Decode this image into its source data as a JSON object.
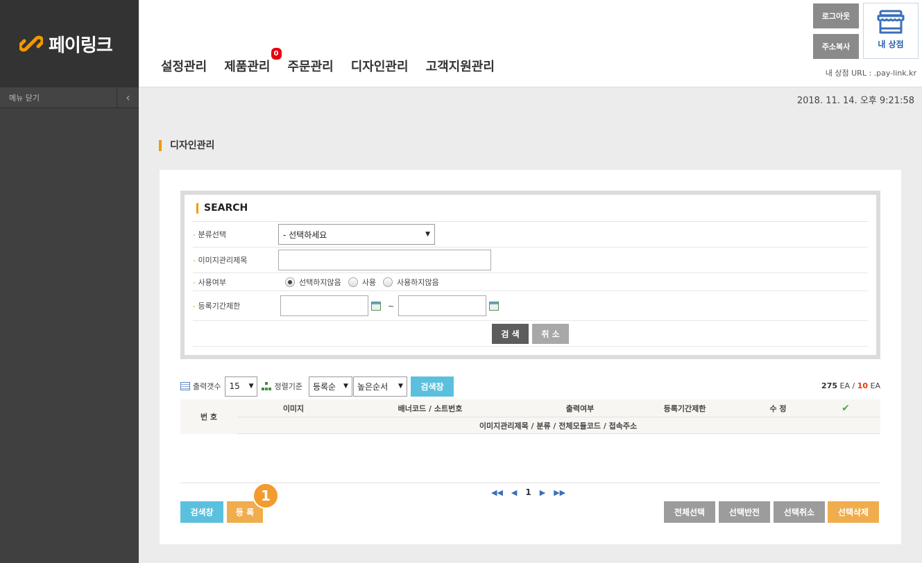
{
  "brand": {
    "name": "페이링크"
  },
  "sidebar": {
    "menu_close": "메뉴 닫기"
  },
  "nav": {
    "items": [
      "설정관리",
      "제품관리",
      "주문관리",
      "디자인관리",
      "고객지원관리"
    ],
    "badge": "0"
  },
  "header": {
    "logout": "로그아웃",
    "copy_address": "주소복사",
    "my_shop": "내 상점",
    "shop_url": "내 상점 URL : .pay-link.kr"
  },
  "timestamp": "2018. 11. 14. 오후 9:21:58",
  "page_title": "디자인관리",
  "search": {
    "title": "SEARCH",
    "category_label": "분류선택",
    "category_value": "- 선택하세요",
    "image_title_label": "이미지관리제목",
    "usage_label": "사용여부",
    "usage_options": [
      "선택하지않음",
      "사용",
      "사용하지않음"
    ],
    "period_label": "등록기간제한",
    "tilde": "~",
    "search_btn": "검 색",
    "cancel_btn": "취 소"
  },
  "listbar": {
    "output_count_label": "출력갯수",
    "output_count_value": "15",
    "sort_label": "정렬기준",
    "sort_by": "등록순",
    "sort_order": "높은순서",
    "search_window_btn": "검색창",
    "total": "275",
    "ea1": "EA /",
    "page_count": "10",
    "ea2": "EA"
  },
  "table": {
    "num": "번 호",
    "headers": [
      "이미지",
      "배너코드 / 소트번호",
      "출력여부",
      "등록기간제한",
      "수 정"
    ],
    "sub_header": "이미지관리제목 / 분류 / 전체모듈코드 / 접속주소"
  },
  "pager": {
    "current": "1"
  },
  "bottom": {
    "search_window": "검색창",
    "register": "등 록",
    "select_all": "전체선택",
    "select_invert": "선택반전",
    "select_cancel": "선택취소",
    "select_delete": "선택삭제",
    "step": "1"
  }
}
